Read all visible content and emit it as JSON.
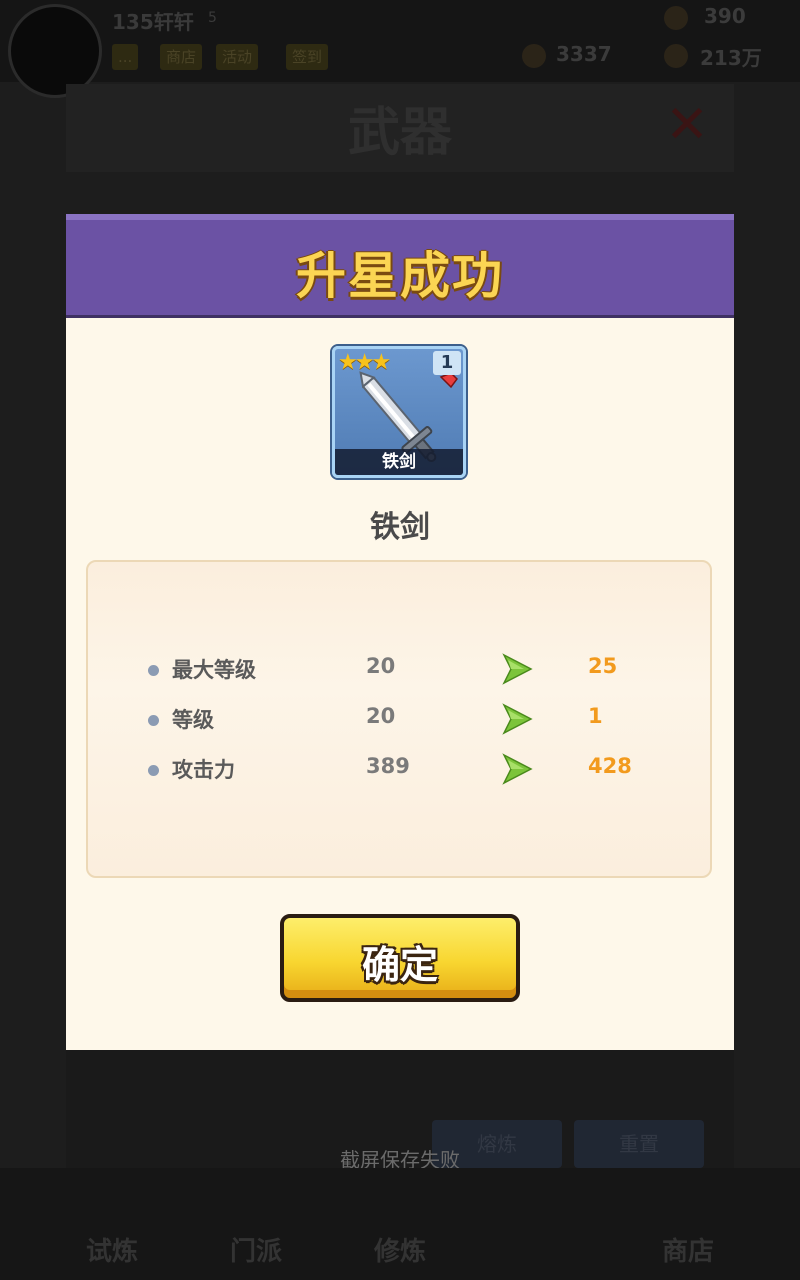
{
  "background": {
    "player": {
      "name": "135轩轩",
      "level": "5"
    },
    "tags": [
      "...",
      "商店",
      "活动",
      "签到"
    ],
    "resources": {
      "energy": "390",
      "gems": "3337",
      "gold": "213万"
    },
    "panel_title": "武器",
    "toast": "截屏保存失败",
    "bottom_buttons": [
      "熔炼",
      "重置"
    ],
    "nav": [
      "试炼",
      "门派",
      "修炼",
      "",
      "商店"
    ]
  },
  "modal": {
    "title": "升星成功",
    "item": {
      "name": "铁剑",
      "card_label": "铁剑",
      "stars": "★★★",
      "count": "1",
      "icon": "sword-icon"
    },
    "stats": [
      {
        "label": "最大等级",
        "old": "20",
        "new": "25"
      },
      {
        "label": "等级",
        "old": "20",
        "new": "1"
      },
      {
        "label": "攻击力",
        "old": "389",
        "new": "428"
      }
    ],
    "confirm_label": "确定"
  },
  "colors": {
    "header": "#6b52a4",
    "title": "#fbd553",
    "new_value": "#f29a1d",
    "arrow": "#7cc43a",
    "button": "#f8d630"
  }
}
